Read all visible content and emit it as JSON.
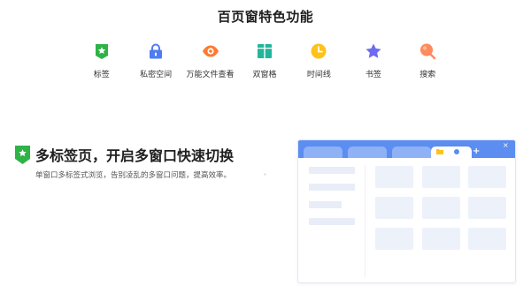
{
  "page": {
    "title": "百页窗特色功能"
  },
  "features": [
    {
      "label": "标签",
      "icon": "tag-star-icon",
      "color": "#2db346"
    },
    {
      "label": "私密空间",
      "icon": "lock-icon",
      "color": "#4f7cf3"
    },
    {
      "label": "万能文件查看",
      "icon": "eye-icon",
      "color": "#ff7a2e"
    },
    {
      "label": "双窗格",
      "icon": "dual-pane-icon",
      "color": "#23b59b"
    },
    {
      "label": "时间线",
      "icon": "clock-icon",
      "color": "#ffc21a"
    },
    {
      "label": "书签",
      "icon": "bookmark-star-icon",
      "color": "#6c6cf0"
    },
    {
      "label": "搜索",
      "icon": "search-icon",
      "color": "#ff8a5c"
    }
  ],
  "section": {
    "heading": "多标签页，开启多窗口快速切换",
    "description": "单窗口多标签式浏览，告别凌乱的多窗口问题，提高效率。",
    "icon": "tag-star-icon",
    "accent": "#2db346"
  },
  "illustration": {
    "plus_glyph": "+",
    "close_glyph": "×",
    "bar_color": "#5c8df0"
  }
}
